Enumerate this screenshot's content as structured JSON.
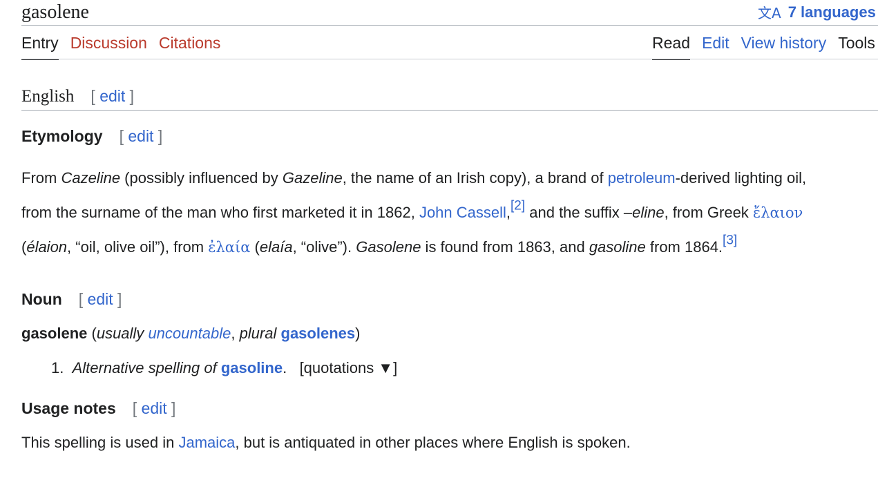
{
  "page": {
    "title": "gasolene",
    "languages": {
      "label": "7 languages"
    }
  },
  "tabs": {
    "left": [
      "Entry",
      "Discussion",
      "Citations"
    ],
    "right": [
      "Read",
      "Edit",
      "View history",
      "Tools"
    ]
  },
  "sections": {
    "language": "English",
    "edit_label": "edit",
    "etymology": {
      "heading": "Etymology",
      "line1": {
        "t1": "From ",
        "cazeline": "Cazeline",
        "t2": " (possibly influenced by ",
        "gazeline": "Gazeline",
        "t3": ", the name of an Irish copy), a brand of ",
        "petroleum": "petroleum",
        "t4": "-derived lighting oil,"
      },
      "line2": {
        "t1": "from the surname of the man who first marketed it in 1862, ",
        "john": "John Cassell",
        "comma": ",",
        "ref2": "[2]",
        "t2": " and the suffix ",
        "eline": "–eline",
        "t3": ", from Greek ",
        "greek1": "ἔλαιον"
      },
      "line3": {
        "open": "(",
        "elaion": "élaion",
        "t1": ", “oil, olive oil”), from ",
        "greek2": "ἐλαία",
        "t2": " (",
        "elaia": "elaía",
        "t3": ", “olive”). ",
        "gasolene": "Gasolene",
        "t4": " is found from 1863, and ",
        "gasoline": "gasoline",
        "t5": " from 1864.",
        "ref3": "[3]"
      }
    },
    "noun": {
      "heading": "Noun",
      "headword": "gasolene",
      "open": " (",
      "usually": "usually",
      "uncountable": "uncountable",
      "comma": ", ",
      "plural": "plural",
      "plural_form": "gasolenes",
      "close": ")",
      "definition": {
        "number": "1.",
        "alt": "Alternative spelling of",
        "target": "gasoline",
        "period": ".",
        "quotations": "[quotations ▼]"
      }
    },
    "usage": {
      "heading": "Usage notes",
      "t1": "This spelling is used in ",
      "jamaica": "Jamaica",
      "t2": ", but is antiquated in other places where English is spoken."
    }
  }
}
